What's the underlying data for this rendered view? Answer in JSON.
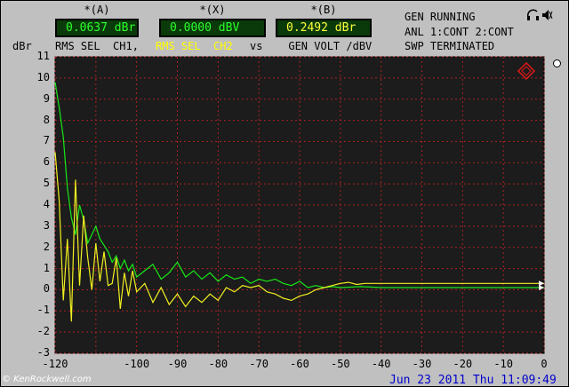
{
  "readouts": [
    {
      "label": "*(A)",
      "value": "0.0637 dBr"
    },
    {
      "label": "*(X)",
      "value": "0.0000 dBV"
    },
    {
      "label": "*(B)",
      "value": "0.2492 dBr"
    }
  ],
  "channel_line": {
    "part1": "RMS SEL  CH1,",
    "part2": "RMS SEL  CH2",
    "part3": "vs    GEN VOLT /dBV"
  },
  "status": [
    "GEN RUNNING",
    "ANL 1:CONT 2:CONT",
    "SWP TERMINATED"
  ],
  "y_unit": "dBr",
  "footer": {
    "watermark": "© KenRockwell.com",
    "datetime": "Jun 23 2011 Thu 11:09:49"
  },
  "colors": {
    "plot_bg": "#1c1c1c",
    "grid": "#b02020",
    "ch1": "#18e818",
    "ch2": "#f0f020",
    "logo": "#e01818"
  },
  "chart_data": {
    "type": "line",
    "xlabel": "",
    "ylabel": "dBr",
    "xlim": [
      -120,
      0
    ],
    "ylim": [
      -3,
      11
    ],
    "x_ticks": [
      -120,
      -100,
      -90,
      -80,
      -70,
      -60,
      -50,
      -40,
      -30,
      -20,
      -10,
      0
    ],
    "y_ticks": [
      11,
      10,
      9,
      8,
      7,
      6,
      5,
      4,
      3,
      2,
      1,
      0,
      -1,
      -2,
      -3
    ],
    "grid": true,
    "series": [
      {
        "color": "#18e818",
        "x": [
          -120,
          -119,
          -118,
          -117,
          -116,
          -115,
          -114,
          -113,
          -112,
          -111,
          -110,
          -109,
          -108,
          -107,
          -106,
          -105,
          -104,
          -103,
          -102,
          -101,
          -100,
          -98,
          -96,
          -94,
          -92,
          -90,
          -88,
          -86,
          -84,
          -82,
          -80,
          -78,
          -76,
          -74,
          -72,
          -70,
          -68,
          -66,
          -64,
          -62,
          -60,
          -58,
          -56,
          -54,
          -52,
          -50,
          -45,
          -40,
          -30,
          -20,
          -10,
          0
        ],
        "y": [
          9.8,
          8.6,
          7.2,
          4.8,
          3.4,
          2.6,
          4.0,
          3.3,
          2.2,
          2.6,
          3.0,
          2.4,
          2.1,
          1.8,
          1.3,
          1.6,
          1.0,
          1.4,
          0.9,
          1.2,
          0.6,
          0.9,
          1.2,
          0.5,
          0.8,
          1.3,
          0.6,
          0.9,
          0.5,
          0.8,
          0.4,
          0.7,
          0.5,
          0.6,
          0.3,
          0.5,
          0.4,
          0.5,
          0.3,
          0.2,
          0.4,
          0.1,
          0.2,
          0.1,
          0.15,
          0.1,
          0.15,
          0.1,
          0.1,
          0.1,
          0.1,
          0.1
        ]
      },
      {
        "color": "#f0f020",
        "x": [
          -120,
          -119,
          -118,
          -117,
          -116,
          -115,
          -114,
          -113,
          -112,
          -111,
          -110,
          -109,
          -108,
          -107,
          -106,
          -105,
          -104,
          -103,
          -102,
          -101,
          -100,
          -98,
          -96,
          -94,
          -92,
          -90,
          -88,
          -86,
          -84,
          -82,
          -80,
          -78,
          -76,
          -74,
          -72,
          -70,
          -68,
          -66,
          -64,
          -62,
          -60,
          -58,
          -56,
          -54,
          -52,
          -50,
          -48,
          -46,
          -44,
          -42,
          -40,
          -30,
          -20,
          -10,
          0
        ],
        "y": [
          6.5,
          4.2,
          -0.5,
          2.4,
          -1.5,
          5.2,
          0.2,
          3.5,
          1.5,
          0.0,
          2.2,
          0.4,
          1.8,
          0.2,
          0.3,
          1.5,
          -0.9,
          0.8,
          -0.3,
          0.9,
          -0.1,
          0.3,
          -0.6,
          0.1,
          -0.7,
          -0.2,
          -0.8,
          -0.3,
          -0.6,
          -0.2,
          -0.5,
          0.1,
          -0.1,
          0.2,
          0.1,
          0.2,
          -0.1,
          -0.2,
          -0.4,
          -0.5,
          -0.3,
          -0.2,
          0.0,
          0.1,
          0.2,
          0.3,
          0.35,
          0.25,
          0.3,
          0.3,
          0.3,
          0.3,
          0.3,
          0.3,
          0.3
        ]
      }
    ]
  }
}
